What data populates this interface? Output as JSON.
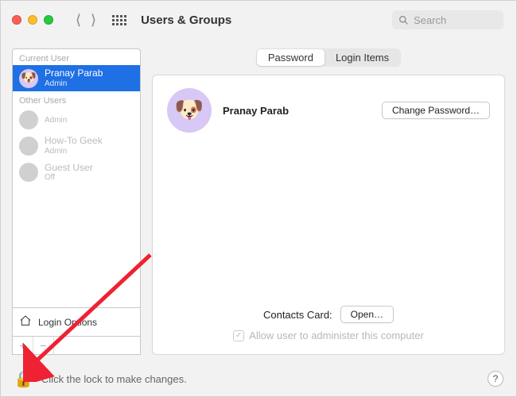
{
  "window": {
    "title": "Users & Groups",
    "search_placeholder": "Search"
  },
  "sidebar": {
    "current_label": "Current User",
    "other_label": "Other Users",
    "login_options_label": "Login Options",
    "current_user": {
      "name": "Pranay Parab",
      "role": "Admin"
    },
    "other_users": [
      {
        "name": "",
        "role": "Admin"
      },
      {
        "name": "How-To Geek",
        "role": "Admin"
      },
      {
        "name": "Guest User",
        "role": "Off"
      }
    ],
    "add_label": "+",
    "remove_label": "−"
  },
  "tabs": {
    "password": "Password",
    "login_items": "Login Items"
  },
  "panel": {
    "display_name": "Pranay Parab",
    "change_password_label": "Change Password…",
    "contacts_label": "Contacts Card:",
    "open_label": "Open…",
    "admin_checkbox_label": "Allow user to administer this computer",
    "admin_checked": true
  },
  "footer": {
    "lock_text": "Click the lock to make changes.",
    "help_label": "?"
  },
  "colors": {
    "selection": "#1f6fe5",
    "avatar_bg": "#d8c8f5"
  }
}
